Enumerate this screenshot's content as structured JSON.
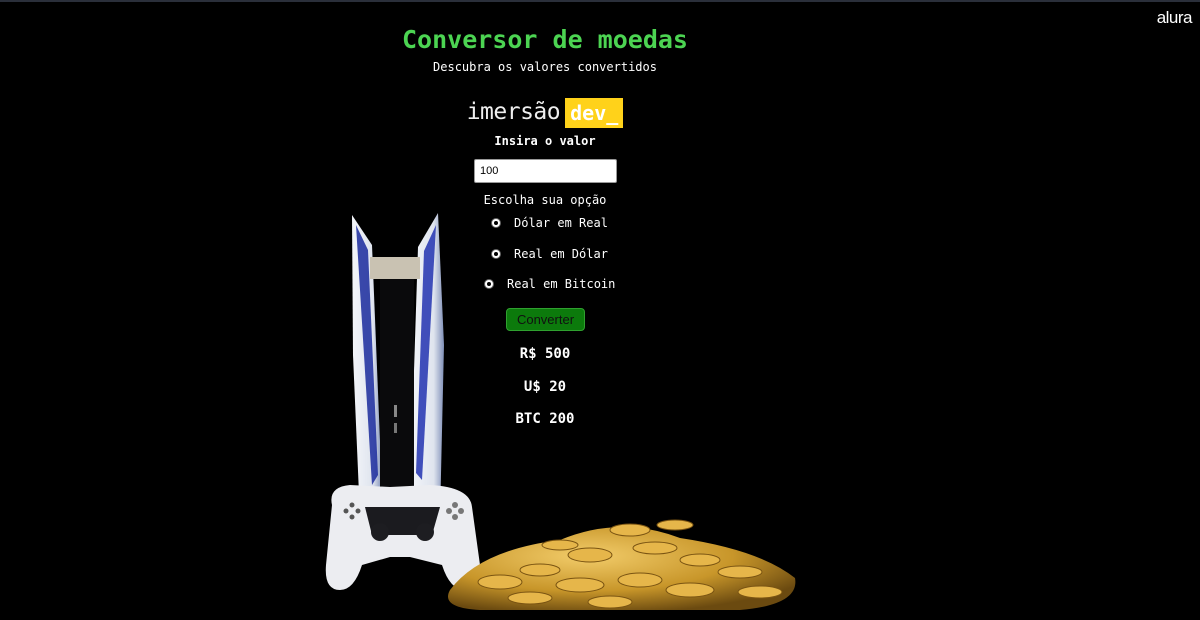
{
  "brand": {
    "name": "alura"
  },
  "header": {
    "title": "Conversor de moedas",
    "subtitle": "Descubra os valores convertidos"
  },
  "logo": {
    "part1": "imersão",
    "part2": "dev_"
  },
  "form": {
    "value_label": "Insira o valor",
    "value_input": "100",
    "options_label": "Escolha sua opção",
    "options": [
      {
        "label": "Dólar em Real"
      },
      {
        "label": "Real em Dólar"
      },
      {
        "label": "Real em Bitcoin"
      }
    ],
    "convert_label": "Converter"
  },
  "results": [
    "R$ 500",
    "U$ 20",
    "BTC 200"
  ],
  "colors": {
    "background": "#000000",
    "title": "#4cd452",
    "logo_accent": "#ffd21a",
    "button": "#0c7a0c"
  }
}
